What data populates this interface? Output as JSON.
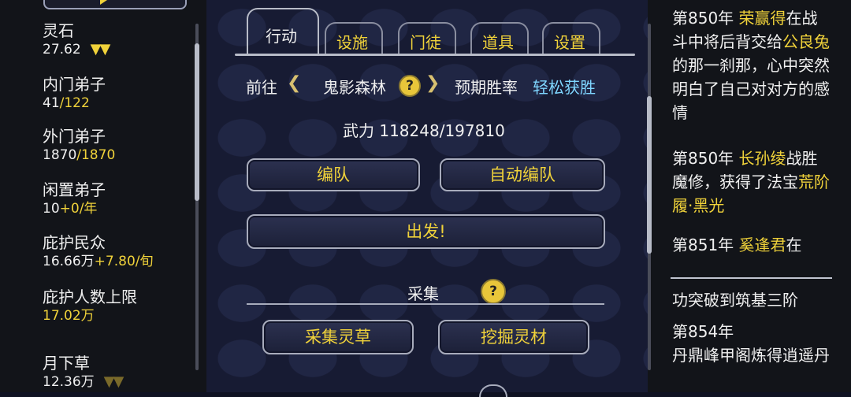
{
  "left": {
    "resources": [
      {
        "label": "灵石",
        "value": "27.62",
        "extra": "",
        "arrows": "▼▼"
      },
      {
        "label": "内门弟子",
        "value": "41",
        "extra": "/122",
        "arrows": ""
      },
      {
        "label": "外门弟子",
        "value": "1870",
        "extra": "/1870",
        "arrows": ""
      },
      {
        "label": "闲置弟子",
        "value": "10",
        "extra": "+0/年",
        "arrows": ""
      },
      {
        "label": "庇护民众",
        "value": "16.66万",
        "extra": "+7.80/旬",
        "arrows": ""
      },
      {
        "label": "庇护人数上限",
        "value": "",
        "extra": "17.02万",
        "arrows": ""
      },
      {
        "label": "月下草",
        "value": "12.36万",
        "extra": "",
        "arrows": "▼▼"
      }
    ]
  },
  "tabs": [
    {
      "label": "行动",
      "active": true
    },
    {
      "label": "设施",
      "active": false
    },
    {
      "label": "门徒",
      "active": false
    },
    {
      "label": "道具",
      "active": false
    },
    {
      "label": "设置",
      "active": false
    }
  ],
  "action": {
    "goto_label": "前往",
    "location": "鬼影森林",
    "win_rate_label": "预期胜率",
    "win_rate_value": "轻松获胜",
    "force_label": "武力 118248/197810",
    "formation_btn": "编队",
    "auto_formation_btn": "自动编队",
    "depart_btn": "出发!",
    "gather_title": "采集",
    "gather_herb_btn": "采集灵草",
    "dig_material_btn": "挖掘灵材",
    "help_glyph": "?"
  },
  "log": {
    "entries_top": [
      {
        "year": "第850年",
        "name": "荣赢得",
        "text": "在战斗中将后背交给",
        "name2": "公良兔",
        "text2": "的那一刹那，心中突然明白了自己对对方的感情"
      },
      {
        "year": "第850年",
        "name": "长孙绫",
        "text": "战胜魔修，获得了法宝",
        "item": "荒阶履·黑光"
      },
      {
        "year": "第851年",
        "name": "奚逢君",
        "text": "在"
      }
    ],
    "entries_bottom": [
      {
        "text": "功突破到筑基三阶"
      },
      {
        "year": "第854年",
        "text": "丹鼎峰甲阁炼得逍遥丹"
      }
    ]
  },
  "colors": {
    "accent": "#f0d23a",
    "cyan": "#7fd6ff",
    "bg": "#171b33"
  }
}
